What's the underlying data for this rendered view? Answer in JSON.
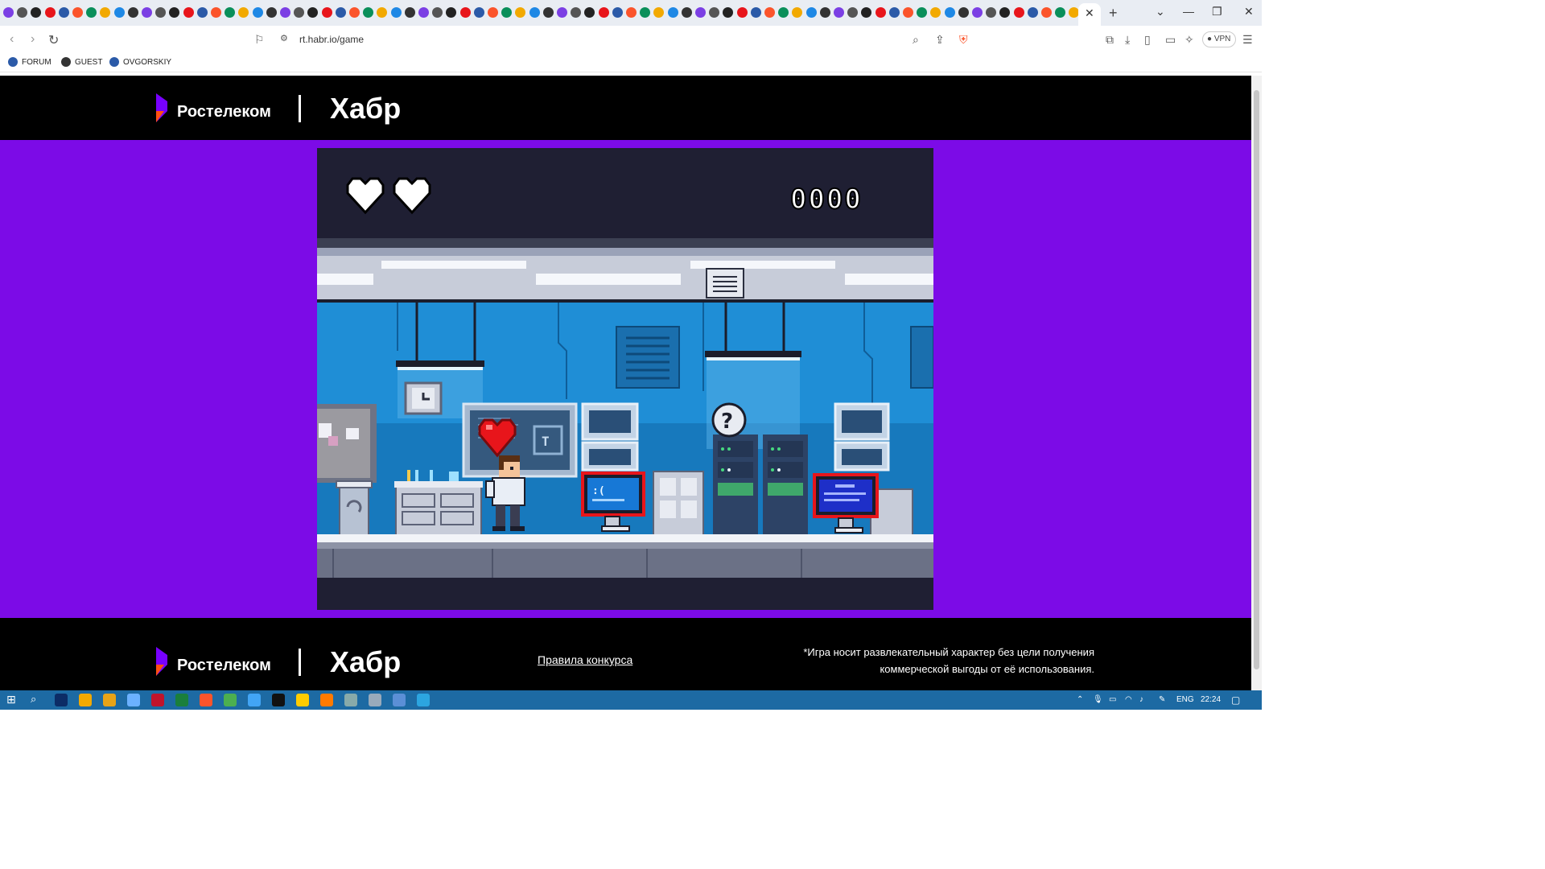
{
  "browser": {
    "url": "rt.habr.io/game",
    "vpn_label": "VPN",
    "bookmarks": [
      {
        "label": "FORUM"
      },
      {
        "label": "GUEST"
      },
      {
        "label": "OVGORSKIY"
      }
    ]
  },
  "header": {
    "brand_name": "Ростелеком",
    "partner_name": "Хабр"
  },
  "game": {
    "lives": 2,
    "score": "0000"
  },
  "footer": {
    "brand_name": "Ростелеком",
    "partner_name": "Хабр",
    "rules_link": "Правила конкурса",
    "disclaimer_line1": "*Игра носит развлекательный характер без цели получения",
    "disclaimer_line2": "коммерческой выгоды от её использования."
  },
  "taskbar": {
    "language": "ENG",
    "time": "22:24"
  },
  "colors": {
    "page_background": "#7c0be7",
    "brand_purple": "#7700ff",
    "brand_orange": "#ff4f12"
  }
}
